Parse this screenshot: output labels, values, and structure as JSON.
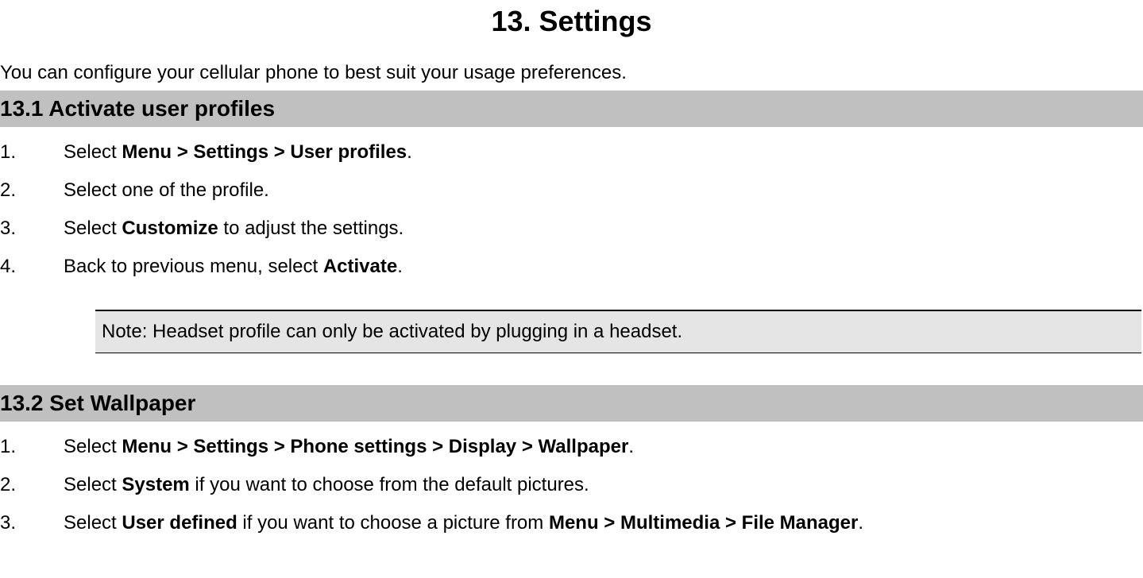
{
  "title": "13. Settings",
  "intro": "You can configure your cellular phone to best suit your usage preferences.",
  "section1": {
    "heading_num": "13.1",
    "heading_text": "Activate user profiles",
    "steps": [
      {
        "num": "1.",
        "prefix": "Select ",
        "bold1": "Menu > Settings > User profiles",
        "suffix": "."
      },
      {
        "num": "2.",
        "text": "Select one of the profile."
      },
      {
        "num": "3.",
        "prefix": "Select ",
        "bold1": "Customize",
        "suffix": " to adjust the settings."
      },
      {
        "num": "4.",
        "prefix": "Back to previous menu, select ",
        "bold1": "Activate",
        "suffix": "."
      }
    ],
    "note": "Note: Headset profile can only be activated by plugging in a headset."
  },
  "section2": {
    "heading_num": "13.2",
    "heading_text": "Set Wallpaper",
    "steps": [
      {
        "num": "1.",
        "prefix": "Select ",
        "bold1": "Menu > Settings > Phone settings > Display > Wallpaper",
        "suffix": "."
      },
      {
        "num": "2.",
        "prefix": "Select ",
        "bold1": "System",
        "suffix": " if you want to choose from the default pictures."
      },
      {
        "num": "3.",
        "prefix": "Select ",
        "bold1": "User defined",
        "mid": " if you want to choose a picture from ",
        "bold2": "Menu > Multimedia > File Manager",
        "suffix": "."
      }
    ]
  }
}
